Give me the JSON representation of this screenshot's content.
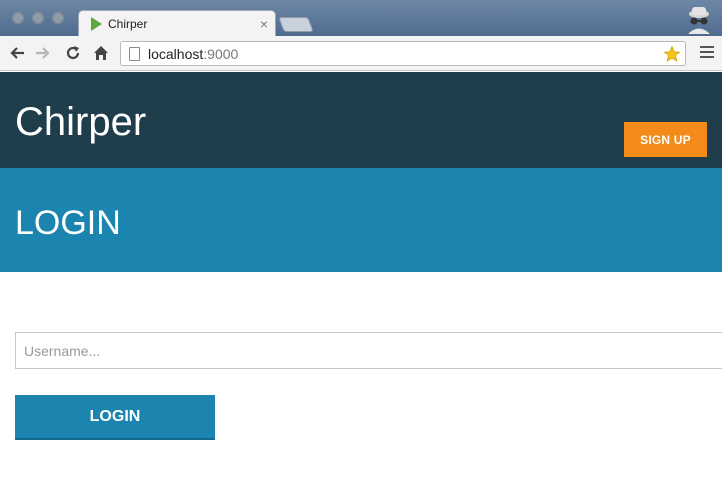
{
  "browser": {
    "tab_title": "Chirper",
    "tab_close": "×",
    "url_host": "localhost",
    "url_port": ":9000"
  },
  "app": {
    "brand": "Chirper",
    "signup_label": "SIGN UP",
    "section_title": "LOGIN",
    "username_placeholder": "Username...",
    "username_value": "",
    "login_label": "LOGIN"
  },
  "colors": {
    "header_bg": "#1f3d4b",
    "hero_bg": "#1b85b0",
    "signup_bg": "#f38b1b",
    "login_bg": "#1b85b0"
  }
}
